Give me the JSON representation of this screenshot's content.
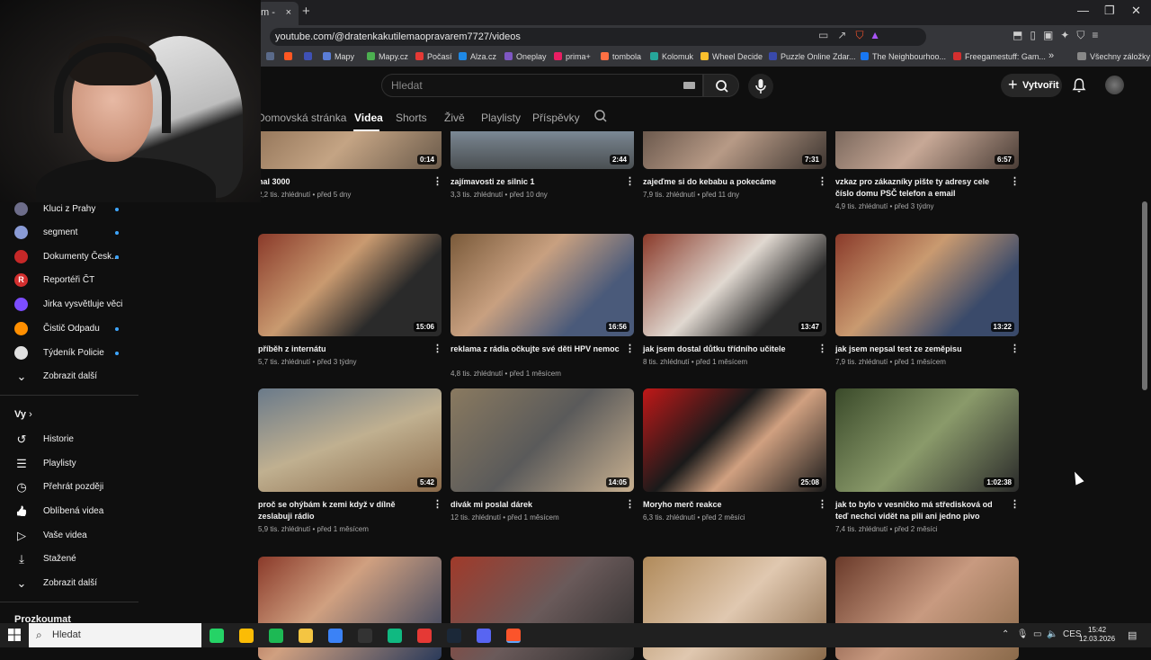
{
  "browser": {
    "tab_label": "m -",
    "tab_close": "×",
    "new_tab": "+",
    "url": "youtube.com/@dratenkakutilemaopravarem7727/videos",
    "window_controls": [
      "—",
      "❐",
      "✕"
    ],
    "bookmarks": [
      {
        "label": "Mapy",
        "color": "#5a7dd6"
      },
      {
        "label": "Mapy.cz",
        "color": "#4caf50"
      },
      {
        "label": "Počasí",
        "color": "#e53935"
      },
      {
        "label": "Alza.cz",
        "color": "#1e88e5"
      },
      {
        "label": "Oneplay",
        "color": "#7e57c2"
      },
      {
        "label": "prima+",
        "color": "#e91e63"
      },
      {
        "label": "tombola",
        "color": "#ff7043"
      },
      {
        "label": "Kolomuk",
        "color": "#26a69a"
      },
      {
        "label": "Wheel Decide",
        "color": "#fbc02d"
      },
      {
        "label": "Puzzle Online Zdar...",
        "color": "#3949ab"
      },
      {
        "label": "The Neighbourhoo...",
        "color": "#1877f2"
      },
      {
        "label": "Freegamestuff: Gam...",
        "color": "#d32f2f"
      },
      {
        "label": "»",
        "color": ""
      },
      {
        "label": "Všechny záložky",
        "color": "#888888"
      }
    ]
  },
  "youtube": {
    "search_placeholder": "Hledat",
    "create_label": "Vytvořit",
    "channel_tabs": [
      "Domovská stránka",
      "Videa",
      "Shorts",
      "Živě",
      "Playlisty",
      "Příspěvky"
    ],
    "active_tab": "Videa"
  },
  "sidebar": {
    "subscriptions": [
      {
        "label": "Kluci z Prahy",
        "color": "#6d6d8a"
      },
      {
        "label": "segment",
        "color": "#8a9bd6"
      },
      {
        "label": "Dokumenty Česk...",
        "color": "#c62828"
      },
      {
        "label": "Reportéři ČT",
        "color": "#d32f2f",
        "letter": "R"
      },
      {
        "label": "Jirka vysvětluje věci",
        "color": "#7c4dff"
      },
      {
        "label": "Čistič Odpadu",
        "color": "#ff8f00"
      },
      {
        "label": "Týdeník Policie",
        "color": "#e0e0e0"
      }
    ],
    "show_more": "Zobrazit další",
    "you_heading": "Vy",
    "you_items": [
      {
        "label": "Historie",
        "icon": "history-icon",
        "glyph": "↺"
      },
      {
        "label": "Playlisty",
        "icon": "playlist-icon",
        "glyph": "☰"
      },
      {
        "label": "Přehrát později",
        "icon": "clock-icon",
        "glyph": "◷"
      },
      {
        "label": "Oblíbená videa",
        "icon": "thumbs-up-icon",
        "glyph": "👍"
      },
      {
        "label": "Vaše videa",
        "icon": "video-icon",
        "glyph": "▷"
      },
      {
        "label": "Stažené",
        "icon": "download-icon",
        "glyph": "⤓"
      }
    ],
    "show_more_2": "Zobrazit další",
    "explore_heading": "Prozkoumat"
  },
  "videos": [
    {
      "title": "hal 3000",
      "views": "2,2 tis. zhlédnutí",
      "age": "před 5 dny",
      "duration": "0:14",
      "bg": "linear-gradient(135deg,#8b6d52,#c4a484 50%,#6a5a4a)"
    },
    {
      "title": "zajímavosti ze silnic 1",
      "views": "3,3 tis. zhlédnutí",
      "age": "před 10 dny",
      "duration": "2:44",
      "bg": "linear-gradient(180deg,#9bb3c8,#6d7780 55%,#4a4f52)"
    },
    {
      "title": "zajeďme si do kebabu a pokecáme",
      "views": "7,9 tis. zhlédnutí",
      "age": "před 11 dny",
      "duration": "7:31",
      "bg": "linear-gradient(135deg,#5a4a40,#b79a86 50%,#3d3530)"
    },
    {
      "title": "vzkaz pro zákazníky pište ty adresy cele číslo domu PSČ telefon a email",
      "views": "4,9 tis. zhlédnutí",
      "age": "před 3 týdny",
      "duration": "6:57",
      "bg": "linear-gradient(135deg,#6a5a50,#c7a896 50%,#4a3d36)"
    },
    {
      "title": "příběh z internátu",
      "views": "5,7 tis. zhlédnutí",
      "age": "před 3 týdny",
      "duration": "15:06",
      "bg": "linear-gradient(135deg,#8a3a2a,#c99a70 40%,#2a2a2a 70%)"
    },
    {
      "title": "reklama z rádia očkujte své děti HPV nemoc",
      "views": "4,8 tis. zhlédnutí",
      "age": "před 1 měsícem",
      "duration": "16:56",
      "bg": "linear-gradient(135deg,#7a5a3a,#c8a080 40%,#4a5a7a 75%)"
    },
    {
      "title": "jak jsem dostal důtku třídního učitele",
      "views": "8 tis. zhlédnutí",
      "age": "před 1 měsícem",
      "duration": "13:47",
      "bg": "linear-gradient(135deg,#8a3a2a,#e0d8d0 45%,#2a2a2a 75%)"
    },
    {
      "title": "jak jsem nepsal test ze zeměpisu",
      "views": "7,9 tis. zhlédnutí",
      "age": "před 1 měsícem",
      "duration": "13:22",
      "bg": "linear-gradient(135deg,#8a3a2a,#c99a70 40%,#3a4a6a 75%)"
    },
    {
      "title": "proč se ohýbám k zemi když v dílně zeslabuji rádio",
      "views": "5,9 tis. zhlédnutí",
      "age": "před 1 měsícem",
      "duration": "5:42",
      "bg": "linear-gradient(160deg,#6a7a8a,#c0b090 50%,#8a6a4a)"
    },
    {
      "title": "divák mi poslal dárek",
      "views": "12 tis. zhlédnutí",
      "age": "před 1 měsícem",
      "duration": "14:05",
      "bg": "linear-gradient(135deg,#8a7a60,#5a5a5a 50%,#c8b090)"
    },
    {
      "title": "Moryho merč reakce",
      "views": "6,3 tis. zhlédnutí",
      "age": "před 2 měsíci",
      "duration": "25:08",
      "bg": "linear-gradient(135deg,#c01818,#1a1a1a 40%,#d0a080 60%,#1a1a1a)"
    },
    {
      "title": "jak to bylo v vesničko má středisková od teď nechci vidět na pili ani jedno pivo",
      "views": "7,4 tis. zhlédnutí",
      "age": "před 2 měsíci",
      "duration": "1:02:38",
      "bg": "linear-gradient(135deg,#3a4a2a,#8a9a6a 50%,#2a2a2a)"
    },
    {
      "title": "",
      "views": "",
      "age": "",
      "duration": "",
      "bg": "linear-gradient(135deg,#8a3a2a,#d0a080 40%,#2a3a5a)"
    },
    {
      "title": "",
      "views": "",
      "age": "",
      "duration": "",
      "bg": "linear-gradient(135deg,#a03a2a,#6a5a5a 50%,#2a2a2a)"
    },
    {
      "title": "",
      "views": "",
      "age": "",
      "duration": "",
      "bg": "linear-gradient(135deg,#b08a5a,#e0c8b0 50%,#8a6a4a)"
    },
    {
      "title": "",
      "views": "",
      "age": "",
      "duration": "",
      "bg": "linear-gradient(135deg,#6a3a2a,#c89a80 50%,#8a6a4a)"
    }
  ],
  "taskbar": {
    "search_placeholder": "Hledat",
    "apps": [
      {
        "name": "whatsapp-icon",
        "color": "#25d366"
      },
      {
        "name": "chrome-icon",
        "color": "#fbbc05"
      },
      {
        "name": "spotify-icon",
        "color": "#1db954"
      },
      {
        "name": "file-explorer-icon",
        "color": "#f4c542"
      },
      {
        "name": "app-blue-icon",
        "color": "#3b82f6"
      },
      {
        "name": "capcut-icon",
        "color": "#333333"
      },
      {
        "name": "app-green-icon",
        "color": "#10b981"
      },
      {
        "name": "app-red-icon",
        "color": "#e53935"
      },
      {
        "name": "steam-icon",
        "color": "#1b2838"
      },
      {
        "name": "discord-icon",
        "color": "#5865f2"
      },
      {
        "name": "brave-icon",
        "color": "#fb542b"
      }
    ],
    "tray_lang": "CES",
    "time": "15:42",
    "date": "12.03.2026"
  }
}
